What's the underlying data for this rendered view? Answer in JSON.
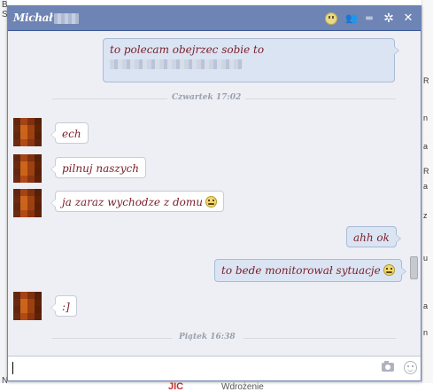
{
  "chat": {
    "contact_name": "Michał",
    "accent_color": "#6d84b4",
    "title_icons": [
      "smiley-icon",
      "add-friends-icon",
      "video-call-icon",
      "gear-icon",
      "close-icon"
    ],
    "close_glyph": "✕",
    "gear_glyph": "✲",
    "add_glyph": "👥",
    "video_glyph": "▬"
  },
  "messages": [
    {
      "side": "out",
      "text": "to polecam obejrzec sobie to"
    },
    {
      "type": "timestamp",
      "text": "Czwartek 17:02"
    },
    {
      "side": "in",
      "text": "ech"
    },
    {
      "side": "in",
      "text": "pilnuj naszych"
    },
    {
      "side": "in",
      "text": "ja zaraz wychodze z domu"
    },
    {
      "side": "out",
      "text": "ahh ok"
    },
    {
      "side": "out",
      "text": "to bede monitorował sytuacje"
    },
    {
      "side": "in",
      "text": ":]"
    },
    {
      "type": "timestamp",
      "text": "Piątek 16:38"
    }
  ],
  "background": {
    "left_snippets": [
      "Błażej Stankiewicz",
      "Notatki"
    ],
    "right_snippets": [
      "R",
      "n",
      "a",
      "R",
      "a",
      "z",
      "u",
      "a",
      "n"
    ],
    "bottom_red": "JIC",
    "bottom_text": "Wdrożenie"
  },
  "input": {
    "value": ""
  }
}
